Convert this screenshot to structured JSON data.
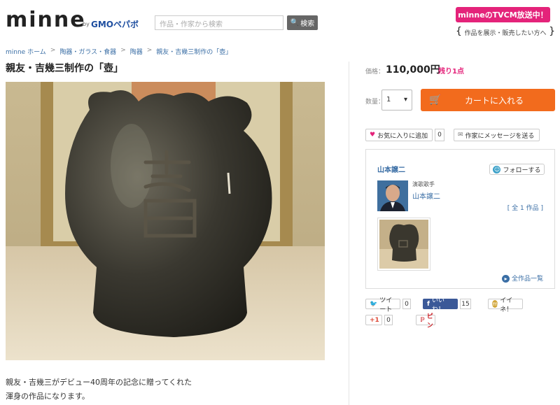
{
  "header": {
    "logo": "minne",
    "logo_by": "by",
    "logo_brand": "GMOペパボ",
    "search_placeholder": "作品・作家から検索",
    "search_button": "検索",
    "tvcm_banner": "minneのTVCM放送中！",
    "tagline": "作品を展示・販売したい方へ"
  },
  "breadcrumb": [
    "minne ホーム",
    "陶器・ガラス・食器",
    "陶器",
    "親友・吉幾三制作の「壺」"
  ],
  "product": {
    "title": "親友・吉幾三制作の「壺」",
    "description_lines": [
      "親友・吉幾三がデビュー40周年の記念に贈ってくれた",
      "渾身の作品になります。"
    ]
  },
  "purchase": {
    "price_label": "価格：",
    "price": "110,000円",
    "stock": "残り1点",
    "qty_label": "数量：",
    "qty_value": "1",
    "cart_button": "カートに入れる",
    "favorite_button": "お気に入りに追加",
    "favorite_count": "0",
    "message_button": "作家にメッセージを送る"
  },
  "creator": {
    "name": "山本譲二",
    "follow_button": "フォローする",
    "role": "演歌歌手",
    "link_name": "山本譲二",
    "works_count": "[ 全 1 作品 ]",
    "all_works": "全作品一覧"
  },
  "social": {
    "tweet": "ツイート",
    "tweet_count": "0",
    "like": "いいね！",
    "like_count": "15",
    "iine": "イイネ！",
    "gplus": "+1",
    "gplus_count": "0",
    "pin": "ピン"
  },
  "colors": {
    "accent_orange": "#f26b1d",
    "accent_pink": "#e4237a",
    "link_blue": "#3a6ea5"
  }
}
